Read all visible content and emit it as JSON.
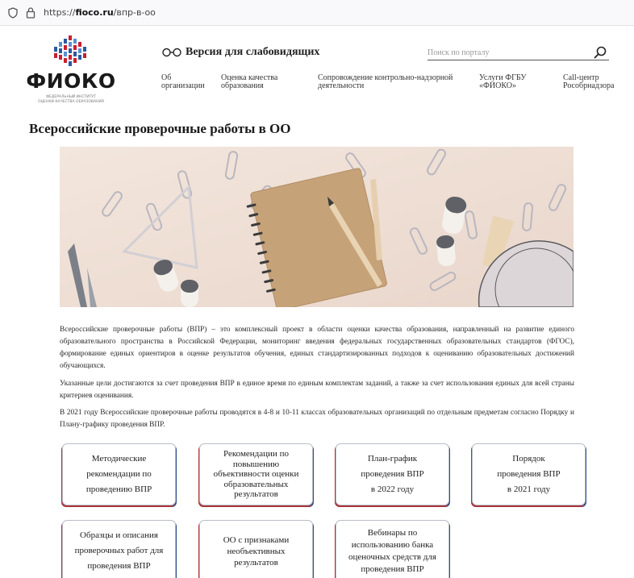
{
  "browser": {
    "url_prefix": "https://",
    "url_domain": "fioco.ru",
    "url_path": "/впр-в-оо"
  },
  "header": {
    "logo_text": "ФИОКО",
    "logo_subtitle_line1": "ФЕДЕРАЛЬНЫЙ ИНСТИТУТ",
    "logo_subtitle_line2": "ОЦЕНКИ КАЧЕСТВА ОБРАЗОВАНИЯ",
    "accessibility_label": "Версия для слабовидящих",
    "search_placeholder": "Поиск по порталу",
    "nav": [
      {
        "line1": "Об",
        "line2": "организации"
      },
      {
        "line1": "Оценка качества",
        "line2": "образования"
      },
      {
        "line1": "Сопровождение контрольно-надзорной",
        "line2": "деятельности"
      },
      {
        "line1": "Услуги ФГБУ",
        "line2": "«ФИОКО»"
      },
      {
        "line1": "Call-центр",
        "line2": "Рособрнадзора"
      }
    ]
  },
  "main": {
    "title": "Всероссийские проверочные работы в ОО",
    "paragraphs": [
      "Всероссийские проверочные работы (ВПР) – это комплексный проект в области оценки качества образования, направленный на развитие единого образовательного пространства в Российской Федерации, мониторинг введения федеральных государственных образовательных стандартов (ФГОС), формирование единых ориентиров в оценке результатов обучения, единых стандартизированных подходов к оцениванию образовательных достижений обучающихся.",
      "Указанные цели достигаются за счет проведения ВПР в единое время по единым комплектам заданий, а также за счет использования единых для всей страны критериев оценивания.",
      "В 2021 году Всероссийские проверочные работы проводятся в 4-8 и 10-11 классах образовательных организаций по отдельным предметам согласно Порядку и Плану-графику проведения ВПР."
    ],
    "cards": [
      {
        "lines": [
          "Методические",
          "рекомендации по",
          "проведению ВПР"
        ]
      },
      {
        "lines": [
          "Рекомендации по",
          "повышению",
          "объективности оценки",
          "образовательных",
          "результатов"
        ]
      },
      {
        "lines": [
          "План-график",
          "проведения ВПР",
          "в 2022 году"
        ]
      },
      {
        "lines": [
          "Порядок",
          "проведения ВПР",
          "в 2021 году"
        ]
      },
      {
        "lines": [
          "Образцы и описания",
          "проверочных работ для",
          "проведения ВПР"
        ]
      },
      {
        "lines": [
          "ОО с признаками",
          "необъективных",
          "результатов"
        ]
      },
      {
        "lines": [
          "Вебинары по",
          "использованию банка",
          "оценочных средств для",
          "проведения ВПР"
        ]
      }
    ]
  },
  "colors": {
    "card_accent_red": "#a9343a",
    "card_accent_blue": "#2f4e8a",
    "logo_blue": "#2c5aa0",
    "logo_red": "#c8202f"
  }
}
